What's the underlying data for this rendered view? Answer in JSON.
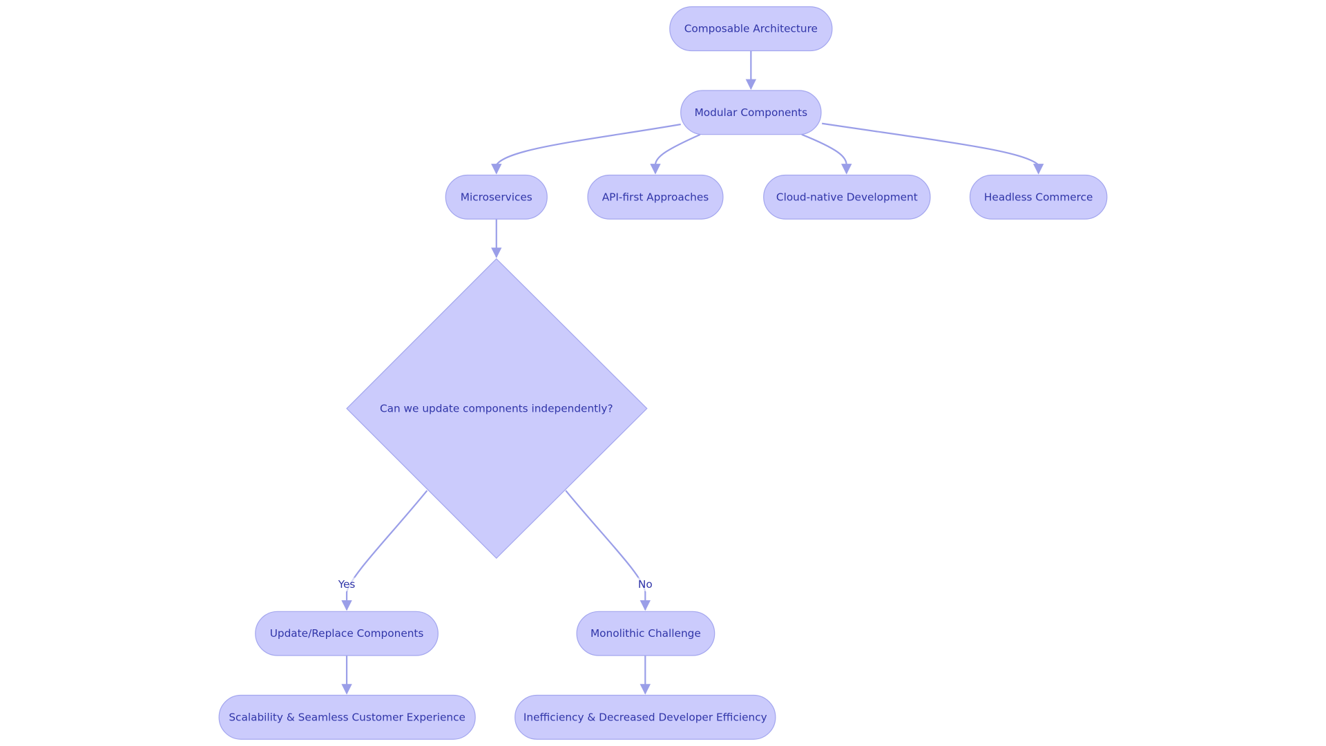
{
  "diagram": {
    "type": "flowchart",
    "colors": {
      "node_fill": "#cbcbfc",
      "node_stroke": "#a3a6ee",
      "text": "#3035a8",
      "edge": "#9a9ee8"
    },
    "nodes": {
      "composable": "Composable Architecture",
      "modular": "Modular Components",
      "microservices": "Microservices",
      "api_first": "API-first Approaches",
      "cloud_native": "Cloud-native Development",
      "headless": "Headless Commerce",
      "decision": "Can we update components independently?",
      "update": "Update/Replace Components",
      "monolithic": "Monolithic Challenge",
      "scalability": "Scalability & Seamless Customer Experience",
      "inefficiency": "Inefficiency & Decreased Developer Efficiency"
    },
    "edges": [
      {
        "from": "composable",
        "to": "modular"
      },
      {
        "from": "modular",
        "to": "microservices"
      },
      {
        "from": "modular",
        "to": "api_first"
      },
      {
        "from": "modular",
        "to": "cloud_native"
      },
      {
        "from": "modular",
        "to": "headless"
      },
      {
        "from": "microservices",
        "to": "decision"
      },
      {
        "from": "decision",
        "to": "update",
        "label": "Yes"
      },
      {
        "from": "decision",
        "to": "monolithic",
        "label": "No"
      },
      {
        "from": "update",
        "to": "scalability"
      },
      {
        "from": "monolithic",
        "to": "inefficiency"
      }
    ]
  }
}
